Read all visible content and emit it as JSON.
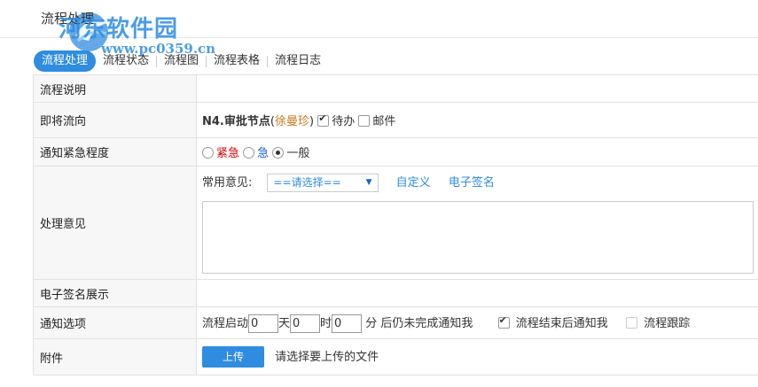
{
  "header": {
    "title": "流程处理"
  },
  "watermark": {
    "brand": "河东软件园",
    "url": "www.pc0359.cn"
  },
  "tabs": [
    {
      "label": "流程处理",
      "active": true
    },
    {
      "label": "流程状态"
    },
    {
      "label": "流程图"
    },
    {
      "label": "流程表格"
    },
    {
      "label": "流程日志"
    }
  ],
  "form": {
    "description": {
      "label": "流程说明"
    },
    "next": {
      "label": "即将流向",
      "node": "N4.审批节点",
      "assignee": "徐曼珍",
      "paren_open": "(",
      "paren_close": ")",
      "todo_label": "待办",
      "mail_label": "邮件"
    },
    "urgency": {
      "label": "通知紧急程度",
      "options": [
        "紧急",
        "急",
        "一般"
      ],
      "selected": "一般"
    },
    "opinion": {
      "label": "处理意见",
      "common_label": "常用意见:",
      "select_value": "==请选择==",
      "custom_link": "自定义",
      "esign_link": "电子签名"
    },
    "esign_display": {
      "label": "电子签名展示"
    },
    "notify": {
      "label": "通知选项",
      "start_prefix": "流程启动",
      "days_value": "0",
      "days_unit": "天",
      "hours_value": "0",
      "hours_unit": "时",
      "minutes_value": "0",
      "minutes_unit": "分",
      "suffix": "后仍未完成通知我",
      "end_notify_label": "流程结束后通知我",
      "track_label": "流程跟踪"
    },
    "attachment": {
      "label": "附件",
      "upload_label": "上传",
      "hint": "请选择要上传的文件"
    }
  },
  "colors": {
    "accent": "#2f8ce0",
    "urgent": "#dd0000",
    "semi_urgent": "#1f5fd6",
    "assignee": "#c8781f"
  }
}
